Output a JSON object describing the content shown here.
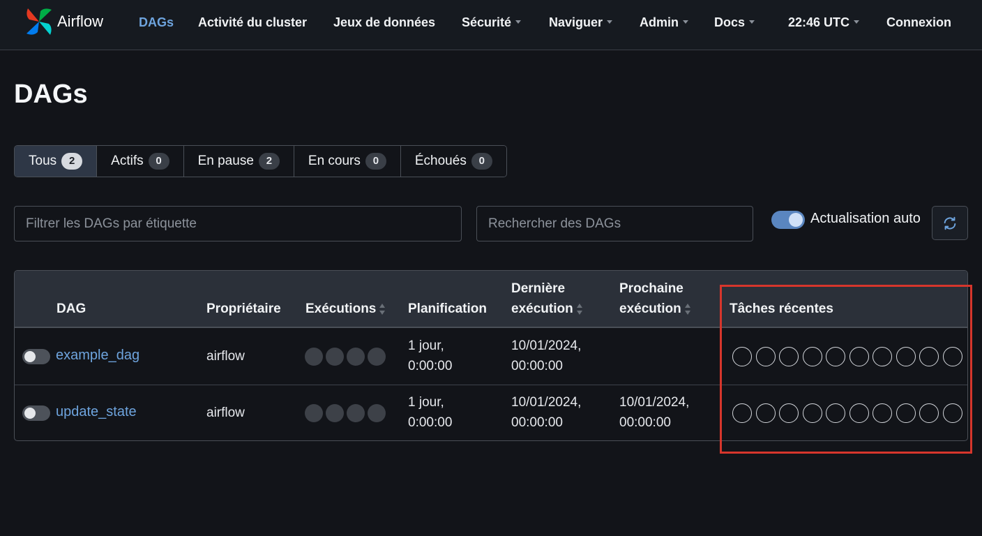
{
  "brand": {
    "name": "Airflow"
  },
  "nav": {
    "dags": "DAGs",
    "cluster": "Activité du cluster",
    "datasets": "Jeux de données",
    "security": "Sécurité",
    "browse": "Naviguer",
    "admin": "Admin",
    "docs": "Docs",
    "time": "22:46 UTC",
    "login": "Connexion"
  },
  "page": {
    "title": "DAGs"
  },
  "status_tabs": [
    {
      "label": "Tous",
      "count": "2"
    },
    {
      "label": "Actifs",
      "count": "0"
    },
    {
      "label": "En pause",
      "count": "2"
    },
    {
      "label": "En cours",
      "count": "0"
    },
    {
      "label": "Échoués",
      "count": "0"
    }
  ],
  "filters": {
    "tag_placeholder": "Filtrer les DAGs par étiquette",
    "search_placeholder": "Rechercher des DAGs",
    "auto_refresh_label": "Actualisation auto"
  },
  "table": {
    "headers": {
      "dag": "DAG",
      "owner": "Propriétaire",
      "runs": "Exécutions",
      "schedule": "Planification",
      "last_run_1": "Dernière",
      "last_run_2": "exécution",
      "next_run_1": "Prochaine",
      "next_run_2": "exécution",
      "recent_tasks": "Tâches récentes"
    },
    "rows": [
      {
        "dag_id": "example_dag",
        "owner": "airflow",
        "schedule_1": "1 jour,",
        "schedule_2": "0:00:00",
        "last_run_1": "10/01/2024,",
        "last_run_2": "00:00:00",
        "next_run_1": "",
        "next_run_2": ""
      },
      {
        "dag_id": "update_state",
        "owner": "airflow",
        "schedule_1": "1 jour,",
        "schedule_2": "0:00:00",
        "last_run_1": "10/01/2024,",
        "last_run_2": "00:00:00",
        "next_run_1": "10/01/2024,",
        "next_run_2": "00:00:00"
      }
    ]
  },
  "colors": {
    "accent": "#6ea4de",
    "highlight": "#d6362c"
  }
}
